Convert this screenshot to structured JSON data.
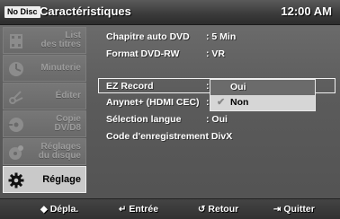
{
  "header": {
    "disc_badge": "No Disc",
    "title": "Caractéristiques",
    "clock": "12:00 AM"
  },
  "sidebar": {
    "items": [
      {
        "label": "List des titres",
        "line1": "List",
        "line2": "des titres",
        "icon": "title-list-icon",
        "active": false
      },
      {
        "label": "Minuterie",
        "icon": "timer-icon",
        "active": false
      },
      {
        "label": "Éditer",
        "icon": "scissors-icon",
        "active": false
      },
      {
        "label": "Copie DV/D8",
        "line1": "Copie",
        "line2": "DV/D8",
        "icon": "copy-icon",
        "active": false
      },
      {
        "label": "Réglages du disque",
        "line1": "Réglages",
        "line2": "du disque",
        "icon": "disc-icon",
        "active": false
      },
      {
        "label": "Réglage",
        "icon": "gear-icon",
        "active": true
      }
    ]
  },
  "settings": {
    "rows": [
      {
        "label": "Chapitre auto DVD",
        "value": ": 5 Min"
      },
      {
        "label": "Format DVD-RW",
        "value": ": VR"
      },
      {
        "label": "EZ Record",
        "value": ":"
      },
      {
        "label": "Anynet+ (HDMI CEC)",
        "value": ":"
      },
      {
        "label": "Sélection langue",
        "value": ": Oui"
      },
      {
        "label": "Code d'enregistrement DivX",
        "value": ""
      }
    ]
  },
  "dropdown": {
    "options": [
      {
        "label": "Oui",
        "selected": false
      },
      {
        "label": "Non",
        "selected": true
      }
    ],
    "check_icon": "checkmark-icon"
  },
  "footer": {
    "move": {
      "label": "Dépla.",
      "icon": "updown-arrow-icon"
    },
    "enter": {
      "label": "Entrée",
      "icon": "enter-icon"
    },
    "return": {
      "label": "Retour",
      "icon": "return-icon"
    },
    "exit": {
      "label": "Quitter",
      "icon": "exit-icon"
    }
  },
  "colors": {
    "background": "#5e5e5e",
    "header": "#333333",
    "active_item": "#c9c9c9",
    "highlight": "#d6d6d6",
    "text": "#ffffff"
  }
}
